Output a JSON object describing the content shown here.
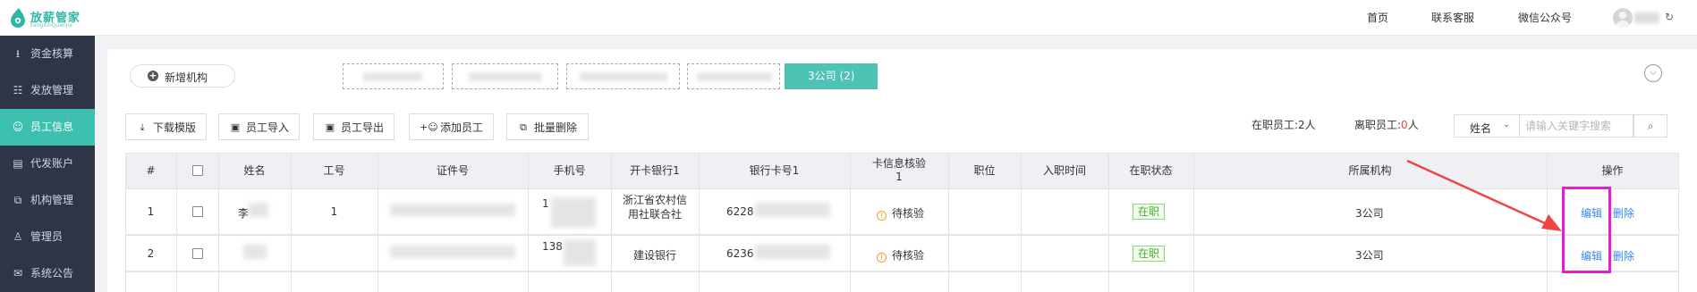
{
  "header": {
    "logo_text": "放薪管家",
    "logo_sub": "FangXinGuanJia",
    "nav": [
      "首页",
      "联系客服",
      "微信公众号"
    ],
    "user_name": "",
    "logout_icon": "logout-icon"
  },
  "sidebar": {
    "items": [
      {
        "label": "资金核算",
        "icon": "bank-icon"
      },
      {
        "label": "发放管理",
        "icon": "document-search-icon"
      },
      {
        "label": "员工信息",
        "icon": "person-icon",
        "active": true
      },
      {
        "label": "代发账户",
        "icon": "wallet-icon"
      },
      {
        "label": "机构管理",
        "icon": "copy-icon"
      },
      {
        "label": "管理员",
        "icon": "user-icon"
      },
      {
        "label": "系统公告",
        "icon": "notice-icon"
      }
    ]
  },
  "org_bar": {
    "add_org_label": "新增机构",
    "active_tab_label": "3公司 (2)"
  },
  "toolbar": {
    "download_label": "下载模版",
    "import_label": "员工导入",
    "export_label": "员工导出",
    "add_label": "添加员工",
    "batch_delete_label": "批量删除"
  },
  "stats": {
    "active_label": "在职员工:",
    "active_count": "2人",
    "left_label": "离职员工:",
    "left_count": "0",
    "left_unit": "人"
  },
  "search": {
    "field_label": "姓名",
    "placeholder": "请输入关键字搜索"
  },
  "table": {
    "columns": [
      "#",
      "",
      "姓名",
      "工号",
      "证件号",
      "手机号",
      "开卡银行1",
      "银行卡号1",
      "卡信息核验1",
      "职位",
      "入职时间",
      "在职状态",
      "所属机构",
      "操作"
    ],
    "rows": [
      {
        "index": "1",
        "name": "李",
        "emp_no": "1",
        "phone": "1",
        "bank": "浙江省农村信用社联合社",
        "card": "6228",
        "verify": "待核验",
        "status": "在职",
        "org": "3公司",
        "edit": "编辑",
        "delete": "删除"
      },
      {
        "index": "2",
        "name": "",
        "emp_no": "",
        "phone": "138",
        "bank": "建设银行",
        "card": "6236",
        "verify": "待核验",
        "status": "在职",
        "org": "3公司",
        "edit": "编辑",
        "delete": "删除"
      }
    ]
  },
  "annotation": {
    "arrow_color": "#f04545",
    "highlight_color": "#e61ed2"
  }
}
